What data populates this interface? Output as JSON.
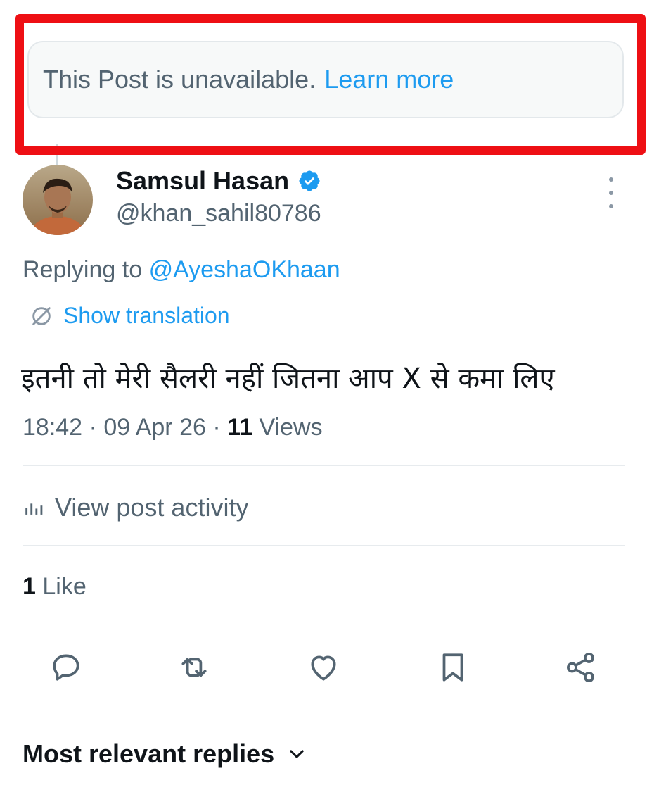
{
  "unavailable_notice": {
    "text": "This Post is unavailable.",
    "link": "Learn more"
  },
  "post": {
    "author_name": "Samsul Hasan",
    "handle": "@khan_sahil80786",
    "replying_label": "Replying to",
    "replying_to": "@AyeshaOKhaan",
    "translation_label": "Show translation",
    "text": "इतनी तो मेरी सैलरी नहीं जितना आप X से कमा लिए",
    "time": "18:42",
    "date": "09 Apr 26",
    "views_count": "11",
    "views_label": "Views"
  },
  "activity": {
    "label": "View post activity"
  },
  "likes": {
    "count": "1",
    "label": "Like"
  },
  "actions": [
    "comment-icon",
    "repost-icon",
    "like-icon",
    "bookmark-icon",
    "share-icon"
  ],
  "replies": {
    "header": "Most relevant replies"
  },
  "colors": {
    "accent": "#1d9bf0",
    "secondary_text": "#536471",
    "highlight_border": "#ee0f14"
  }
}
